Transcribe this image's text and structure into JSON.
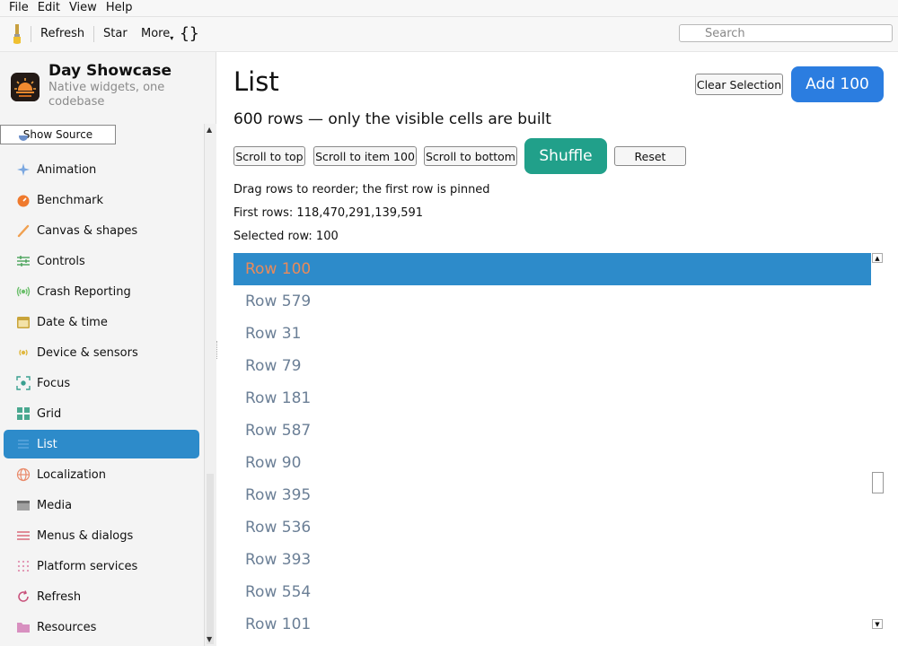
{
  "menubar": {
    "items": [
      "File",
      "Edit",
      "View",
      "Help"
    ]
  },
  "toolbar": {
    "refresh_label": "Refresh",
    "star_label": "Star",
    "more_label": "More",
    "braces_label": "{}",
    "search_placeholder": "Search"
  },
  "sidebar": {
    "app_title": "Day Showcase",
    "app_subtitle": "Native widgets, one codebase",
    "show_source_label": "Show Source",
    "items": [
      {
        "label": "Animation",
        "icon": "sparkle-icon",
        "color": "#7aa7e0"
      },
      {
        "label": "Benchmark",
        "icon": "gauge-icon",
        "color": "#ef7a2d"
      },
      {
        "label": "Canvas & shapes",
        "icon": "brush-icon",
        "color": "#f0a050"
      },
      {
        "label": "Controls",
        "icon": "sliders-icon",
        "color": "#4aa35a"
      },
      {
        "label": "Crash Reporting",
        "icon": "broadcast-icon",
        "color": "#6cbf6c"
      },
      {
        "label": "Date & time",
        "icon": "calendar-icon",
        "color": "#c9a43a"
      },
      {
        "label": "Device & sensors",
        "icon": "sensor-icon",
        "color": "#e0b840"
      },
      {
        "label": "Focus",
        "icon": "focus-icon",
        "color": "#3aa090"
      },
      {
        "label": "Grid",
        "icon": "grid-icon",
        "color": "#4aa890"
      },
      {
        "label": "List",
        "icon": "list-icon",
        "color": "#2d8bca",
        "active": true
      },
      {
        "label": "Localization",
        "icon": "globe-icon",
        "color": "#e98a6a"
      },
      {
        "label": "Media",
        "icon": "clapper-icon",
        "color": "#a0a0a0"
      },
      {
        "label": "Menus & dialogs",
        "icon": "menu-icon",
        "color": "#d96a7a"
      },
      {
        "label": "Platform services",
        "icon": "dots-icon",
        "color": "#e090b0"
      },
      {
        "label": "Refresh",
        "icon": "refresh-icon",
        "color": "#c8507a"
      },
      {
        "label": "Resources",
        "icon": "folder-icon",
        "color": "#d890c0"
      }
    ]
  },
  "main": {
    "title": "List",
    "clear_selection_label": "Clear Selection",
    "add_label": "Add 100",
    "subtitle": "600 rows — only the visible cells are built",
    "buttons": {
      "scroll_top": "Scroll to top",
      "scroll_item": "Scroll to item 100",
      "scroll_bottom": "Scroll to bottom",
      "shuffle": "Shuffle",
      "reset": "Reset"
    },
    "drag_hint": "Drag rows to reorder; the first row is pinned",
    "first_rows": "First rows: 118,470,291,139,591",
    "selected_row": "Selected row: 100",
    "rows": [
      "Row 100",
      "Row 579",
      "Row 31",
      "Row 79",
      "Row 181",
      "Row 587",
      "Row 90",
      "Row 395",
      "Row 536",
      "Row 393",
      "Row 554",
      "Row 101"
    ],
    "selected_index": 0
  },
  "colors": {
    "accent_blue": "#2d8bca",
    "primary_button": "#2b7de0",
    "shuffle_button": "#21a08a",
    "selected_row_text": "#e98a5a",
    "row_text": "#6b7f96"
  }
}
